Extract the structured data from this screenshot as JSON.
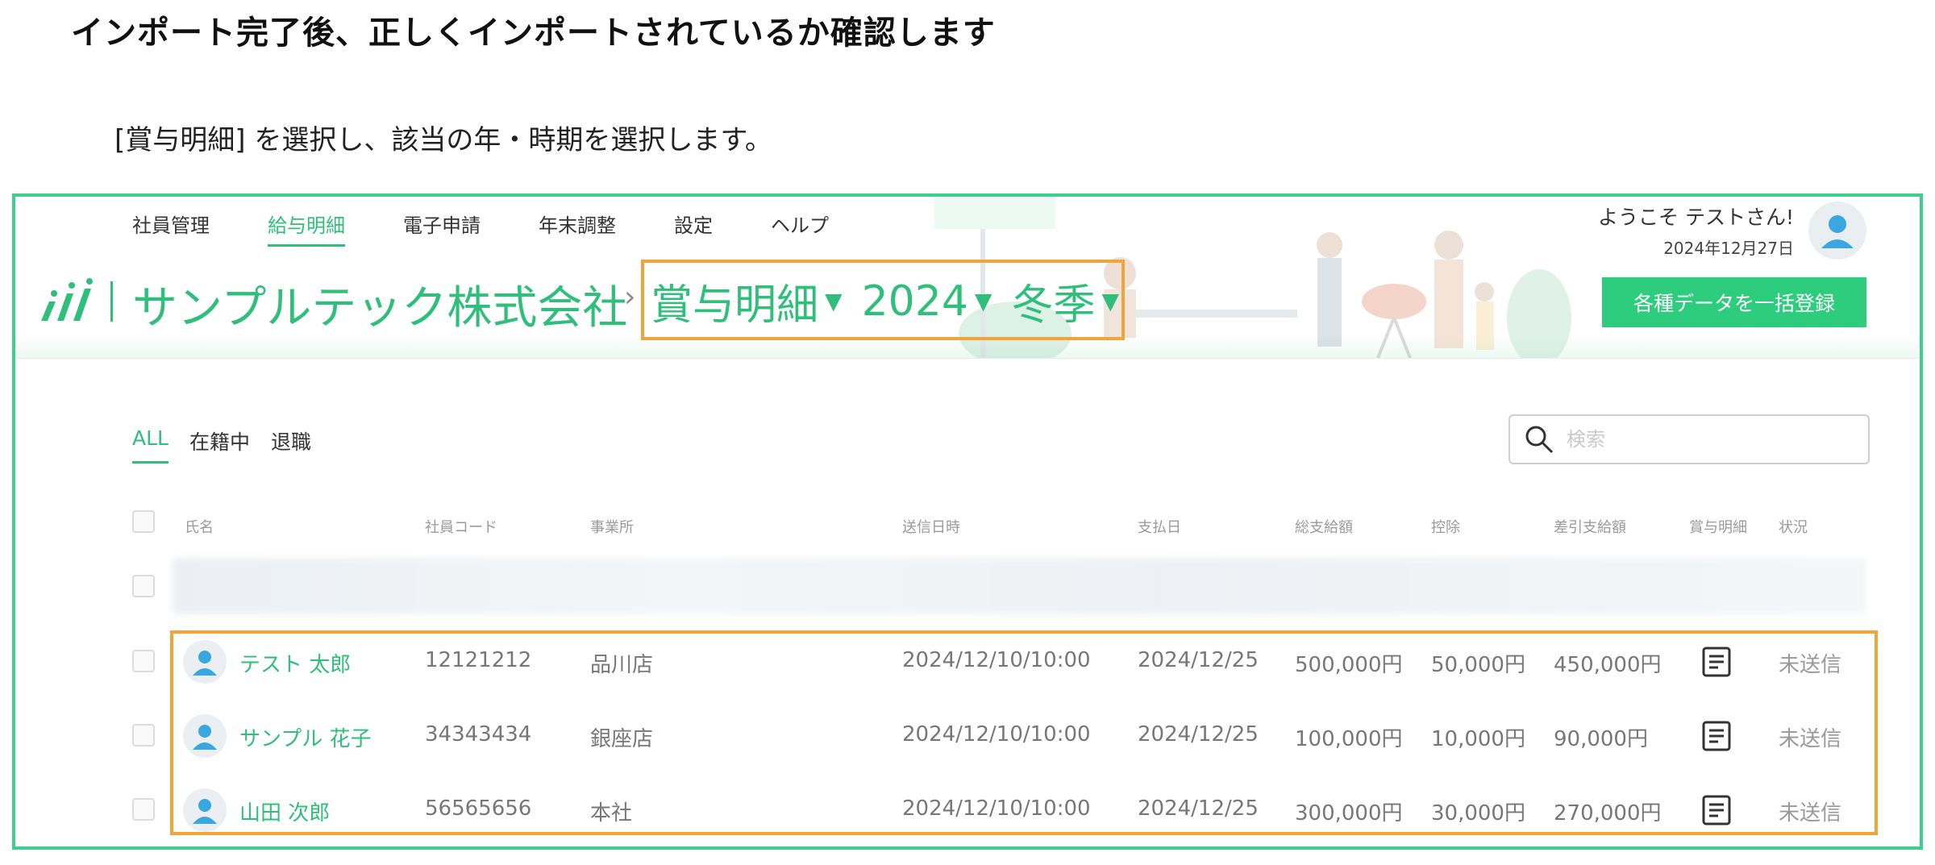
{
  "doc": {
    "heading": "インポート完了後、正しくインポートされているか確認します",
    "instruction": "[賞与明細] を選択し、該当の年・時期を選択します。"
  },
  "nav": {
    "items": [
      "社員管理",
      "給与明細",
      "電子申請",
      "年末調整",
      "設定",
      "ヘルプ"
    ],
    "active": "給与明細"
  },
  "header": {
    "welcome": "ようこそ テストさん!",
    "date": "2024年12月27日",
    "company": "サンプルテック株式会社",
    "separator": "›",
    "period": {
      "doc_type": "賞与明細",
      "year": "2024",
      "season": "冬季"
    },
    "bulk_button": "各種データを一括登録"
  },
  "filters": {
    "tabs": [
      "ALL",
      "在籍中",
      "退職"
    ],
    "active": "ALL"
  },
  "search": {
    "placeholder": "検索"
  },
  "table": {
    "columns": [
      "氏名",
      "社員コード",
      "事業所",
      "送信日時",
      "支払日",
      "総支給額",
      "控除",
      "差引支給額",
      "賞与明細",
      "状況"
    ],
    "rows": [
      {
        "name": "テスト 太郎",
        "code": "12121212",
        "office": "品川店",
        "sent": "2024/12/10/10:00",
        "paid": "2024/12/25",
        "gross": "500,000円",
        "deduction": "50,000円",
        "net": "450,000円",
        "status": "未送信"
      },
      {
        "name": "サンプル 花子",
        "code": "34343434",
        "office": "銀座店",
        "sent": "2024/12/10/10:00",
        "paid": "2024/12/25",
        "gross": "100,000円",
        "deduction": "10,000円",
        "net": "90,000円",
        "status": "未送信"
      },
      {
        "name": "山田 次郎",
        "code": "56565656",
        "office": "本社",
        "sent": "2024/12/10/10:00",
        "paid": "2024/12/25",
        "gross": "300,000円",
        "deduction": "30,000円",
        "net": "270,000円",
        "status": "未送信"
      }
    ]
  },
  "colors": {
    "accent": "#2fbf7a",
    "highlight": "#f0a43a",
    "frame": "#3ecf8e"
  },
  "icons": {
    "search": "search-icon",
    "payslip": "document-icon",
    "avatar": "user-avatar-icon"
  }
}
